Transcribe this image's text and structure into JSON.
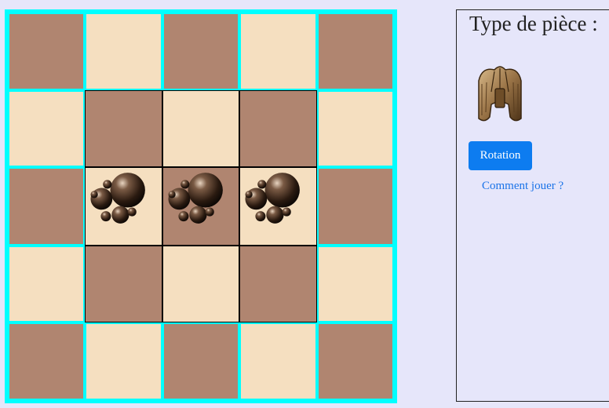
{
  "board": {
    "rows": 5,
    "cols": 5,
    "cells": [
      [
        "dark",
        "light",
        "dark",
        "light",
        "dark"
      ],
      [
        "light",
        "dark",
        "light",
        "dark",
        "light"
      ],
      [
        "dark",
        "light",
        "dark",
        "light",
        "dark"
      ],
      [
        "light",
        "dark",
        "light",
        "dark",
        "light"
      ],
      [
        "dark",
        "light",
        "dark",
        "light",
        "dark"
      ]
    ],
    "inner_region": {
      "rows": [
        1,
        2,
        3
      ],
      "cols": [
        1,
        2,
        3
      ]
    },
    "pieces": [
      {
        "row": 2,
        "col": 1,
        "type": "bomb-cluster"
      },
      {
        "row": 2,
        "col": 2,
        "type": "bomb-cluster"
      },
      {
        "row": 2,
        "col": 3,
        "type": "bomb-cluster"
      }
    ],
    "colors": {
      "dark": "#b08570",
      "light": "#f5dfc0",
      "grid": "#00ffff"
    }
  },
  "panel": {
    "title": "Type de pièce :",
    "piece_icon": "wooden-creature-icon",
    "rotate_label": "Rotation",
    "howto_label": "Comment jouer ?"
  }
}
